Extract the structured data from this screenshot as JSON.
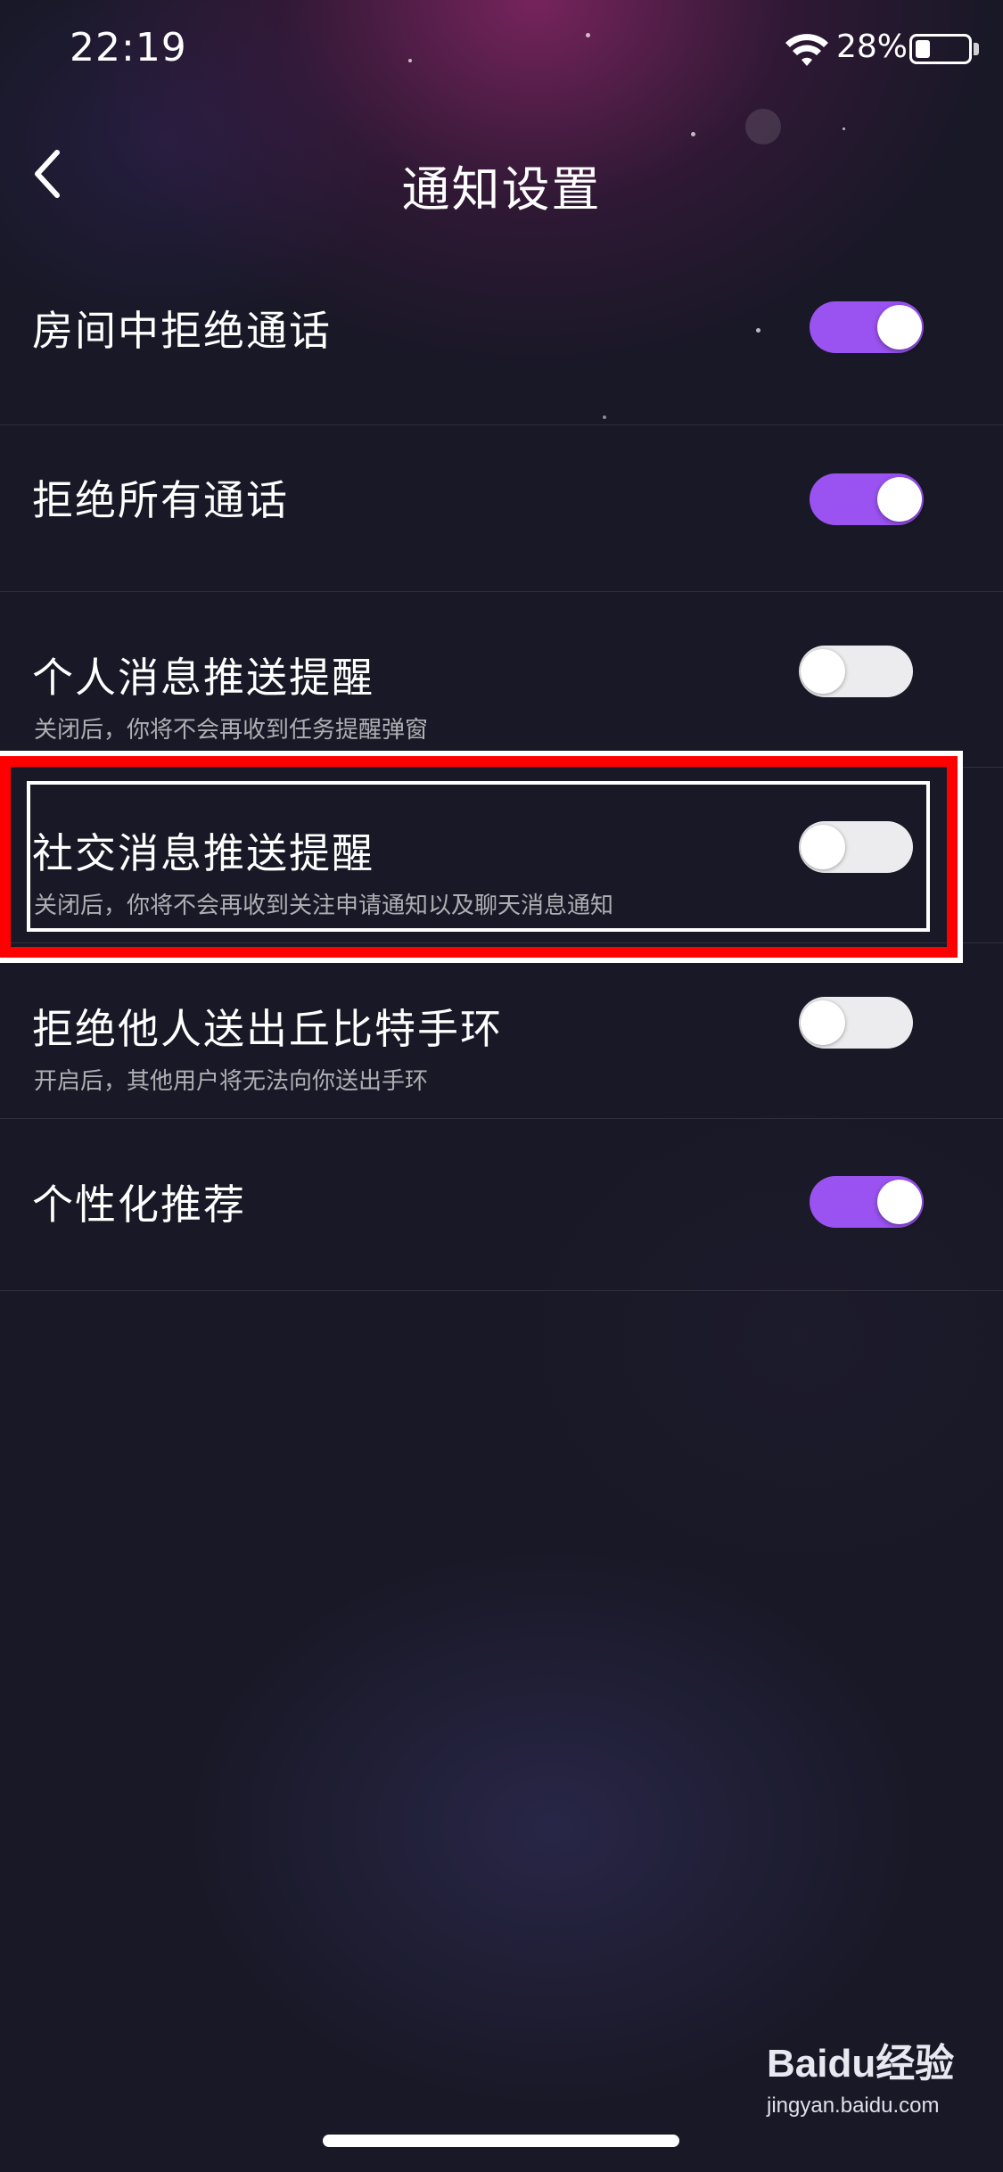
{
  "status_bar": {
    "time": "22:19",
    "battery_percent": "28%",
    "wifi_icon": "wifi-icon",
    "battery_icon": "battery-icon"
  },
  "header": {
    "title": "通知设置",
    "back_icon": "chevron-left-icon"
  },
  "settings": [
    {
      "label": "房间中拒绝通话",
      "subtitle": "",
      "enabled": true
    },
    {
      "label": "拒绝所有通话",
      "subtitle": "",
      "enabled": true
    },
    {
      "label": "个人消息推送提醒",
      "subtitle": "关闭后，你将不会再收到任务提醒弹窗",
      "enabled": false
    },
    {
      "label": "社交消息推送提醒",
      "subtitle": "关闭后，你将不会再收到关注申请通知以及聊天消息通知",
      "enabled": false
    },
    {
      "label": "拒绝他人送出丘比特手环",
      "subtitle": "开启后，其他用户将无法向你送出手环",
      "enabled": false
    },
    {
      "label": "个性化推荐",
      "subtitle": "",
      "enabled": true
    }
  ],
  "colors": {
    "toggle_on": "#9a52f0",
    "highlight": "#ff0000",
    "background": "#181826"
  },
  "watermark": {
    "logo": "Baidu经验",
    "url": "jingyan.baidu.com"
  }
}
